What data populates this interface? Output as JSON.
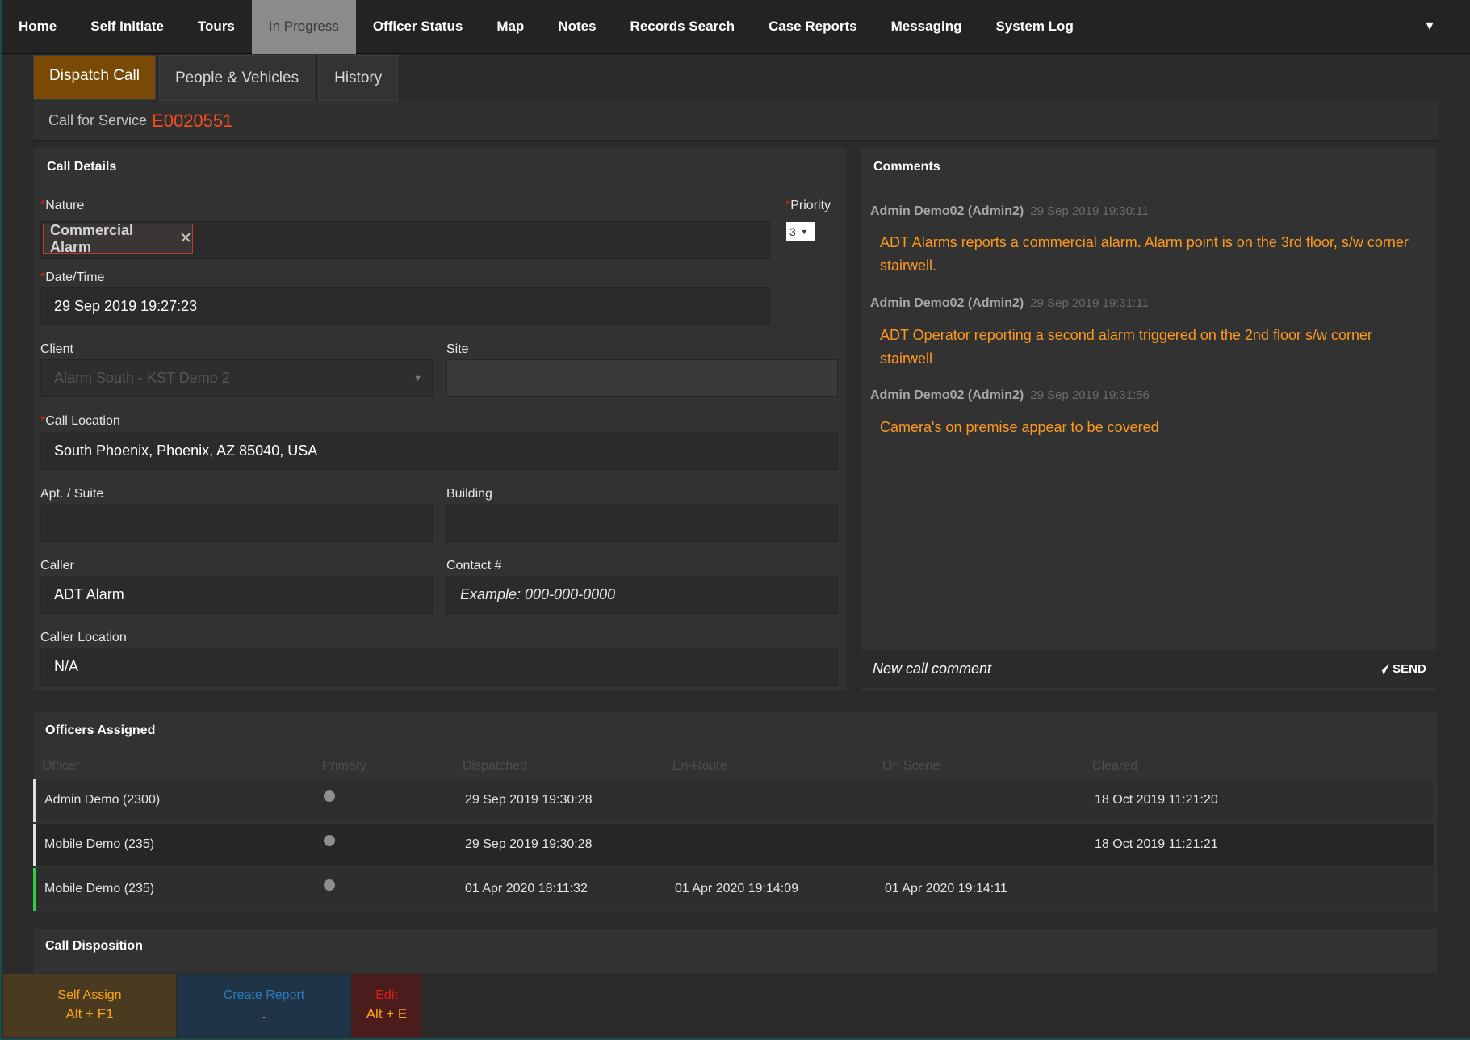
{
  "nav": {
    "items": [
      "Home",
      "Self Initiate",
      "Tours",
      "In Progress",
      "Officer Status",
      "Map",
      "Notes",
      "Records Search",
      "Case Reports",
      "Messaging",
      "System Log"
    ],
    "active": "In Progress"
  },
  "tabs": [
    "Dispatch Call",
    "People & Vehicles",
    "History"
  ],
  "cfs": {
    "label": "Call for Service",
    "number": "E0020551"
  },
  "call_details": {
    "title": "Call Details",
    "nature_label": "Nature",
    "nature_value": "Commercial Alarm",
    "priority_label": "Priority",
    "priority_value": "3",
    "datetime_label": "Date/Time",
    "datetime_value": "29 Sep 2019  19:27:23",
    "client_label": "Client",
    "client_value": "Alarm South - KST Demo 2",
    "site_label": "Site",
    "site_value": "",
    "location_label": "Call Location",
    "location_value": "South Phoenix, Phoenix, AZ 85040, USA",
    "apt_label": "Apt. / Suite",
    "apt_value": "",
    "building_label": "Building",
    "building_value": "",
    "caller_label": "Caller",
    "caller_value": "ADT Alarm",
    "contact_label": "Contact #",
    "contact_placeholder": "Example: 000-000-0000",
    "caller_location_label": "Caller Location",
    "caller_location_value": "N/A"
  },
  "comments": {
    "title": "Comments",
    "items": [
      {
        "author": "Admin Demo02 (Admin2)",
        "time": "29 Sep 2019 19:30:11",
        "text": "ADT Alarms reports a commercial alarm. Alarm point is on the 3rd floor, s/w corner stairwell."
      },
      {
        "author": "Admin Demo02 (Admin2)",
        "time": "29 Sep 2019 19:31:11",
        "text": "ADT Operator reporting a second alarm triggered on the 2nd floor s/w corner stairwell"
      },
      {
        "author": "Admin Demo02 (Admin2)",
        "time": "29 Sep 2019 19:31:56",
        "text": "Camera's on premise appear to be covered"
      }
    ],
    "input_placeholder": "New call comment",
    "send_label": "SEND"
  },
  "officers": {
    "title": "Officers Assigned",
    "headers": [
      "Officer",
      "Primary",
      "Dispatched",
      "En-Route",
      "On Scene",
      "Cleared"
    ],
    "rows": [
      {
        "officer": "Admin Demo (2300)",
        "dispatched": "29 Sep 2019 19:30:28",
        "enroute": "",
        "onscene": "",
        "cleared": "18 Oct 2019 11:21:20",
        "status_color": "#e0e0e0"
      },
      {
        "officer": "Mobile Demo (235)",
        "dispatched": "29 Sep 2019 19:30:28",
        "enroute": "",
        "onscene": "",
        "cleared": "18 Oct 2019 11:21:21",
        "status_color": "#e0e0e0"
      },
      {
        "officer": "Mobile Demo (235)",
        "dispatched": "01 Apr 2020 18:11:32",
        "enroute": "01 Apr 2020 19:14:09",
        "onscene": "01 Apr 2020 19:14:11",
        "cleared": "",
        "status_color": "#2ecc40"
      }
    ]
  },
  "disposition": {
    "title": "Call Disposition"
  },
  "actions": [
    {
      "label": "Self Assign",
      "key": "Alt + F1"
    },
    {
      "label": "Create Report",
      "key": "."
    },
    {
      "label": "Edit",
      "key": "Alt + E"
    }
  ],
  "colors": {
    "accent": "#7a4a05",
    "cfs_number": "#ff4a1c",
    "comment_text": "#ff9a1f",
    "required": "#e02020"
  }
}
